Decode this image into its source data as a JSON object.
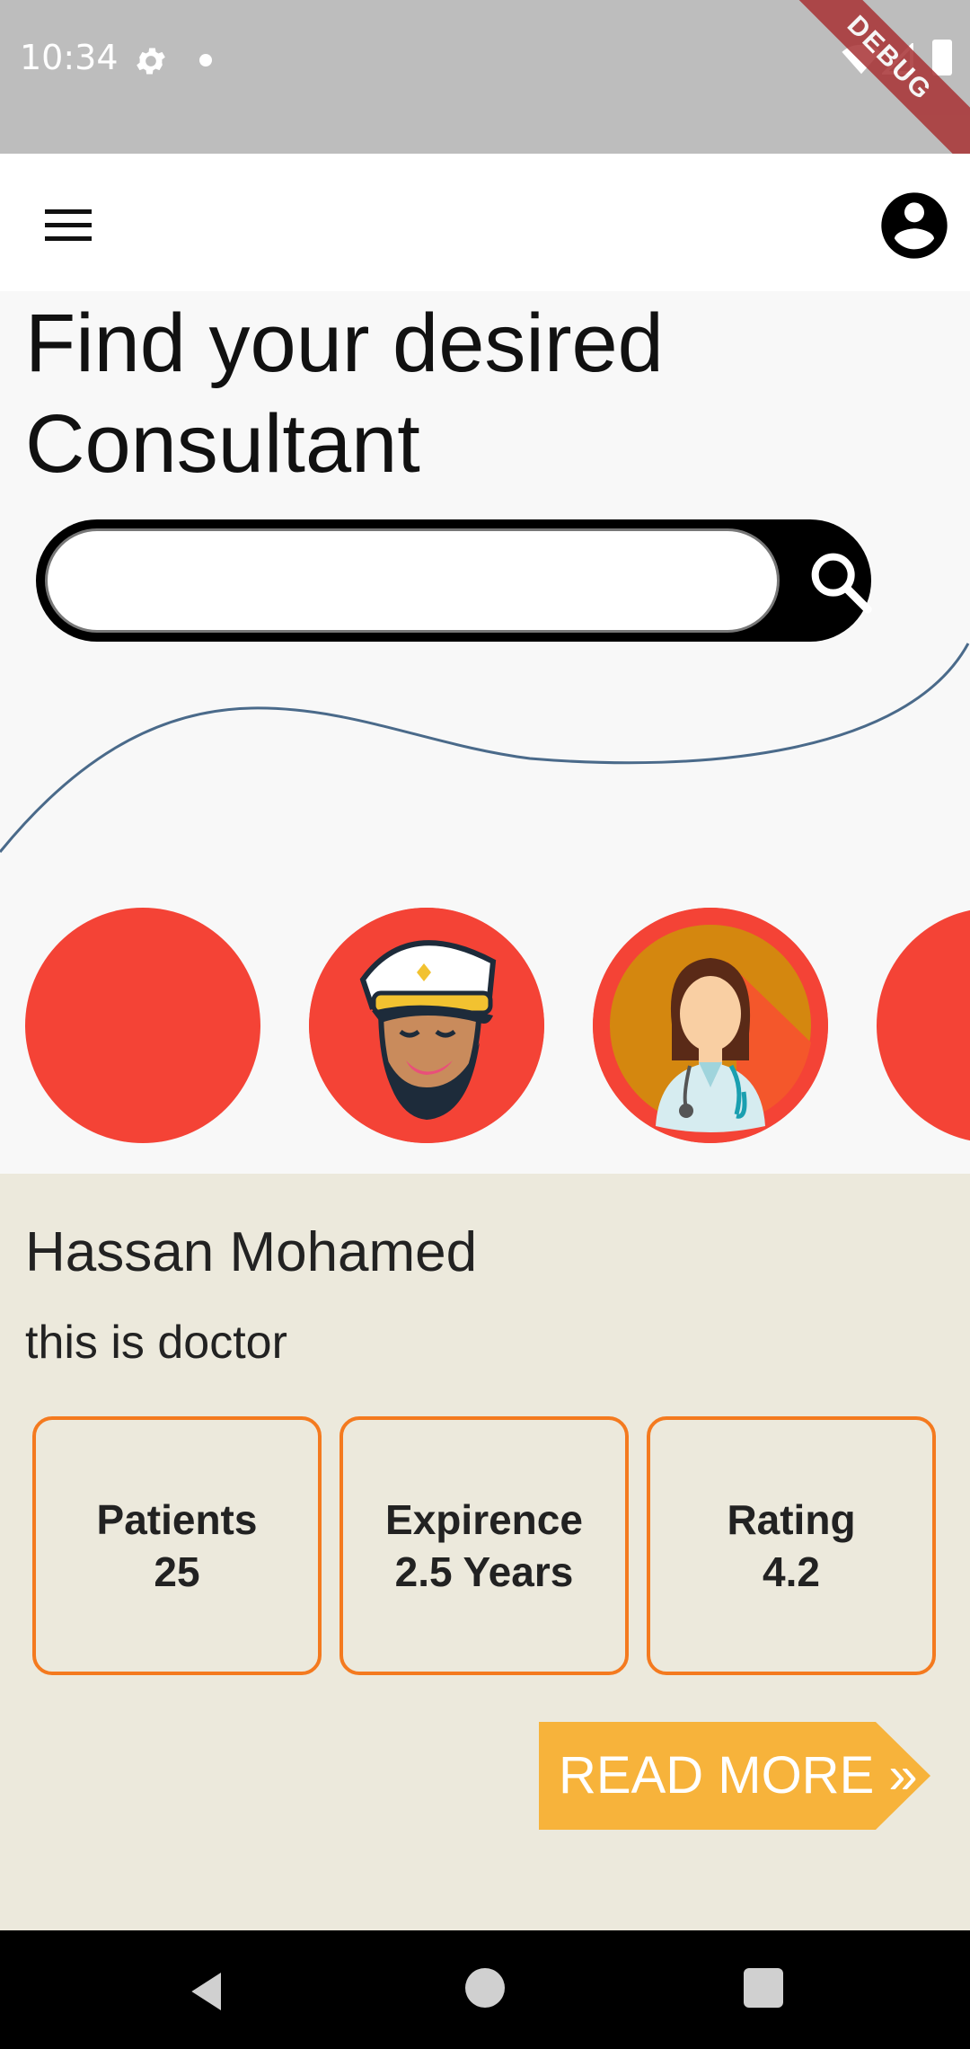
{
  "status_bar": {
    "time": "10:34",
    "debug_label": "DEBUG",
    "icons": [
      "gear-icon",
      "dot-icon",
      "wifi-icon",
      "signal-icon",
      "battery-icon"
    ]
  },
  "app_bar": {
    "menu_icon": "menu-icon",
    "account_icon": "account-circle-icon"
  },
  "headline": "Find your desired Consultant",
  "search": {
    "value": "",
    "placeholder": "",
    "button_icon": "search-icon"
  },
  "avatars": [
    {
      "name": "avatar-empty"
    },
    {
      "name": "avatar-captain"
    },
    {
      "name": "avatar-doctor-female"
    },
    {
      "name": "avatar-partial"
    }
  ],
  "doctor": {
    "name": "Hassan Mohamed",
    "description": "this is doctor",
    "stats": [
      {
        "label": "Patients",
        "value": "25"
      },
      {
        "label": "Expirence",
        "value": "2.5 Years"
      },
      {
        "label": "Rating",
        "value": "4.2"
      }
    ],
    "read_more": "READ MORE »"
  },
  "colors": {
    "accent_red": "#f44336",
    "stat_border": "#f47a1f",
    "read_more_bg": "#f7b33b",
    "detail_bg": "#ece9dc"
  }
}
